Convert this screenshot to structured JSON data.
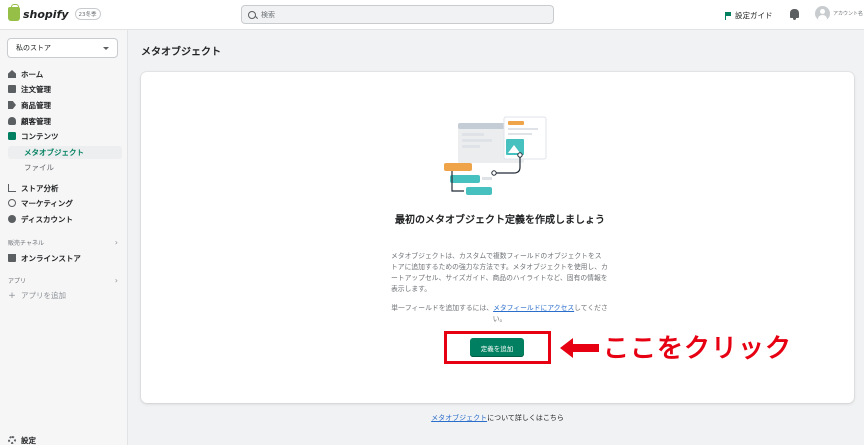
{
  "topbar": {
    "logo_text": "shopify",
    "logo_badge": "23冬季",
    "search_placeholder": "検索",
    "guide_label": "設定ガイド",
    "account_name": "アカウント名"
  },
  "sidebar": {
    "store_select": "私のストア",
    "items": [
      {
        "label": "ホーム",
        "icon": "home-icon"
      },
      {
        "label": "注文管理",
        "icon": "order-icon"
      },
      {
        "label": "商品管理",
        "icon": "tag-icon"
      },
      {
        "label": "顧客管理",
        "icon": "person-icon"
      },
      {
        "label": "コンテンツ",
        "icon": "content-icon"
      }
    ],
    "sub_items": [
      {
        "label": "メタオブジェクト",
        "active": true
      },
      {
        "label": "ファイル",
        "active": false
      }
    ],
    "items2": [
      {
        "label": "ストア分析",
        "icon": "chart-icon"
      },
      {
        "label": "マーケティング",
        "icon": "target-icon"
      },
      {
        "label": "ディスカウント",
        "icon": "discount-icon"
      }
    ],
    "sales_channels": {
      "label": "販売チャネル",
      "item": "オンラインストア"
    },
    "apps": {
      "label": "アプリ",
      "add_label": "アプリを追加"
    },
    "settings_label": "設定"
  },
  "main": {
    "page_title": "メタオブジェクト",
    "empty_title": "最初のメタオブジェクト定義を作成しましょう",
    "empty_desc": "メタオブジェクトは、カスタムで複数フィールドのオブジェクトをストアに追加するための強力な方法です。メタオブジェクトを使用し、カートアップセル、サイズガイド、商品のハイライトなど、固有の情報を表示します。",
    "link_pre": "単一フィールドを追加するには、",
    "link_text": "メタフィールドにアクセス",
    "link_post": "してください。",
    "add_button": "定義を追加",
    "footer_link": "メタオブジェクト",
    "footer_rest": "について詳しくはこちら"
  },
  "annotation": {
    "text": "ここをクリック",
    "color": "#e60012"
  },
  "colors": {
    "accent": "#008060",
    "link": "#2c6ecb"
  }
}
